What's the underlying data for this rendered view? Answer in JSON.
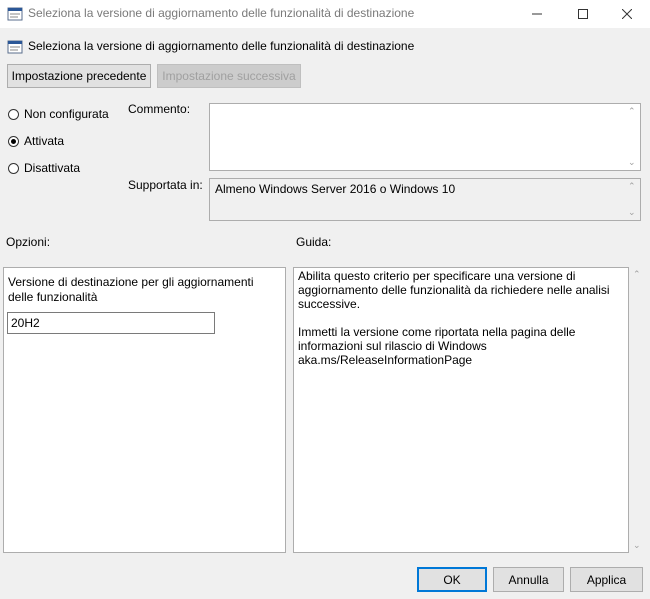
{
  "window": {
    "title": "Seleziona la versione di aggiornamento delle funzionalità di destinazione",
    "controls": {
      "minimize": "—",
      "maximize": "☐",
      "close": "✕"
    }
  },
  "header": {
    "title": "Seleziona la versione di aggiornamento delle funzionalità di destinazione"
  },
  "nav": {
    "prev_label": "Impostazione precedente",
    "next_label": "Impostazione successiva"
  },
  "state": {
    "options": [
      {
        "label": "Non configurata",
        "selected": false
      },
      {
        "label": "Attivata",
        "selected": true
      },
      {
        "label": "Disattivata",
        "selected": false
      }
    ]
  },
  "comment": {
    "label": "Commento:",
    "value": ""
  },
  "supported": {
    "label": "Supportata in:",
    "value": "Almeno Windows Server 2016 o Windows 10"
  },
  "options_panel": {
    "label": "Opzioni:",
    "field_label": "Versione di destinazione per gli aggiornamenti delle funzionalità",
    "field_value": "20H2"
  },
  "help": {
    "label": "Guida:",
    "paragraph1": "Abilita questo criterio per specificare una versione di aggiornamento delle funzionalità da richiedere nelle analisi successive.",
    "paragraph2": "Immetti la versione come riportata nella pagina delle informazioni sul rilascio di Windows aka.ms/ReleaseInformationPage"
  },
  "footer": {
    "ok_label": "OK",
    "cancel_label": "Annulla",
    "apply_label": "Applica"
  },
  "colors": {
    "accent": "#0078d7",
    "background": "#f0f0f0"
  },
  "icons": {
    "window": "policy-icon",
    "header": "policy-icon"
  }
}
